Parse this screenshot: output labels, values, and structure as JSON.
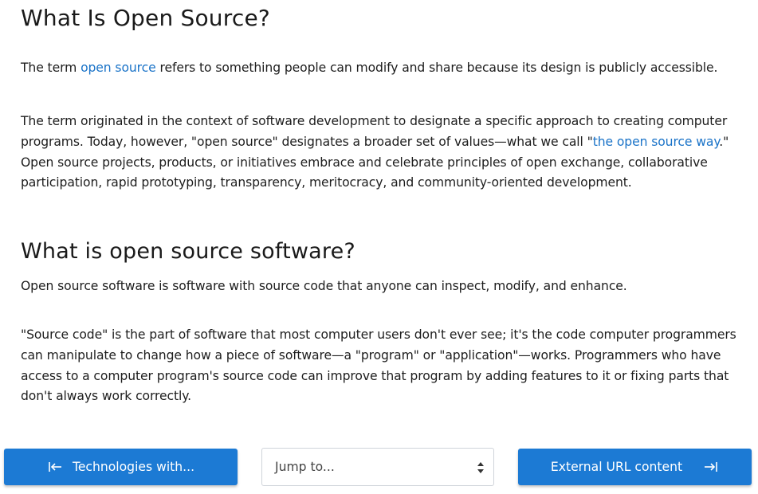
{
  "article": {
    "heading_main": "What Is Open Source?",
    "p1_before": "The term ",
    "p1_link": "open source",
    "p1_after": " refers to something people can modify and share because its design is publicly accessible.",
    "p2_before": "The term originated in the context of software development to designate a specific approach to creating computer programs. Today, however, \"open source\" designates a broader set of values—what we call \"",
    "p2_link": "the open source way",
    "p2_after": ".\" Open source projects, products, or initiatives embrace and celebrate principles of open exchange, collaborative participation, rapid prototyping, transparency, meritocracy, and community-oriented development.",
    "heading_sub": "What is open source software?",
    "p3": "Open source software is software with source code that anyone can inspect, modify, and enhance.",
    "p4": "\"Source code\" is the part of software that most computer users don't ever see; it's the code computer programmers can manipulate to change how a piece of software—a \"program\" or \"application\"—works. Programmers who have access to a computer program's source code can improve that program by adding features to it or fixing parts that don't always work correctly."
  },
  "nav": {
    "prev_label": "Technologies with...",
    "jump_placeholder": "Jump to...",
    "next_label": "External URL content",
    "prev_icon": "arrow-left-to-bar-icon",
    "next_icon": "arrow-right-to-bar-icon",
    "button_color": "#1c7ad4",
    "link_color": "#1a73c8"
  }
}
